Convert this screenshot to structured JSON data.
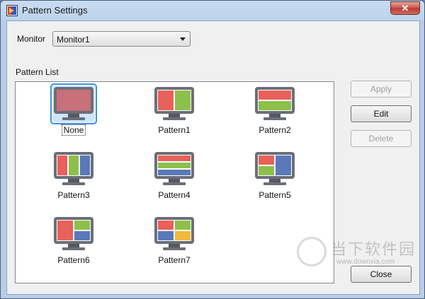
{
  "window": {
    "title": "Pattern Settings",
    "close_glyph": "✕"
  },
  "monitor": {
    "label": "Monitor",
    "selected": "Monitor1"
  },
  "pattern_list": {
    "label": "Pattern List",
    "items": [
      {
        "label": "None",
        "icon": "none-monitor-icon",
        "selected": true
      },
      {
        "label": "Pattern1",
        "icon": "pattern1-monitor-icon",
        "selected": false
      },
      {
        "label": "Pattern2",
        "icon": "pattern2-monitor-icon",
        "selected": false
      },
      {
        "label": "Pattern3",
        "icon": "pattern3-monitor-icon",
        "selected": false
      },
      {
        "label": "Pattern4",
        "icon": "pattern4-monitor-icon",
        "selected": false
      },
      {
        "label": "Pattern5",
        "icon": "pattern5-monitor-icon",
        "selected": false
      },
      {
        "label": "Pattern6",
        "icon": "pattern6-monitor-icon",
        "selected": false
      },
      {
        "label": "Pattern7",
        "icon": "pattern7-monitor-icon",
        "selected": false
      }
    ]
  },
  "buttons": {
    "apply": "Apply",
    "edit": "Edit",
    "delete": "Delete",
    "close": "Close"
  },
  "colors": {
    "red": "#e8615a",
    "green": "#8dc04a",
    "blue": "#5b78b8",
    "yellow": "#f2b83a",
    "none_fill": "#c9707a",
    "monitor_frame": "#6a6f78"
  },
  "watermark": {
    "text": "当下软件园",
    "url": "www.downxia.com"
  }
}
